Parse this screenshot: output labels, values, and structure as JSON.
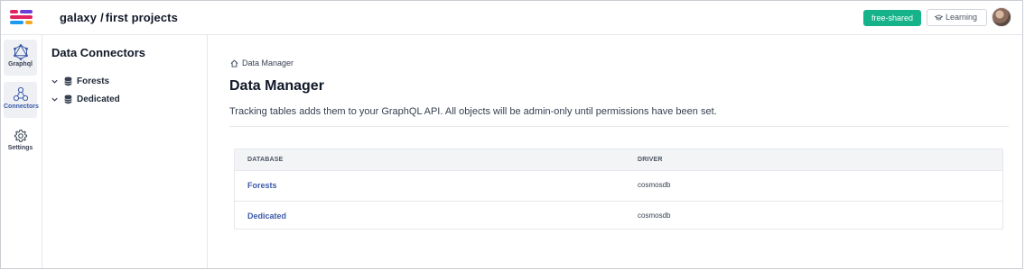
{
  "header": {
    "project": "galaxy",
    "section": "first projects",
    "plan_label": "free-shared",
    "learning_label": "Learning",
    "logo_colors": [
      "#e0245e",
      "#6b3fd4",
      "#f5a623",
      "#1e9bf0"
    ]
  },
  "rail": {
    "items": [
      {
        "label": "Graphql",
        "icon": "graphql-icon"
      },
      {
        "label": "Connectors",
        "icon": "connectors-icon"
      },
      {
        "label": "Settings",
        "icon": "gear-icon"
      }
    ]
  },
  "tree": {
    "title": "Data Connectors",
    "items": [
      {
        "label": "Forests",
        "icon": "database-icon"
      },
      {
        "label": "Dedicated",
        "icon": "database-icon"
      }
    ]
  },
  "main": {
    "breadcrumb": "Data Manager",
    "title": "Data Manager",
    "description": "Tracking tables adds them to your GraphQL API. All objects will be admin-only until permissions have been set.",
    "table": {
      "headers": [
        "DATABASE",
        "DRIVER"
      ],
      "rows": [
        {
          "database": "Forests",
          "driver": "cosmosdb"
        },
        {
          "database": "Dedicated",
          "driver": "cosmosdb"
        }
      ]
    }
  },
  "colors": {
    "accent_green": "#16b38a",
    "link_blue": "#3b5aa8"
  }
}
